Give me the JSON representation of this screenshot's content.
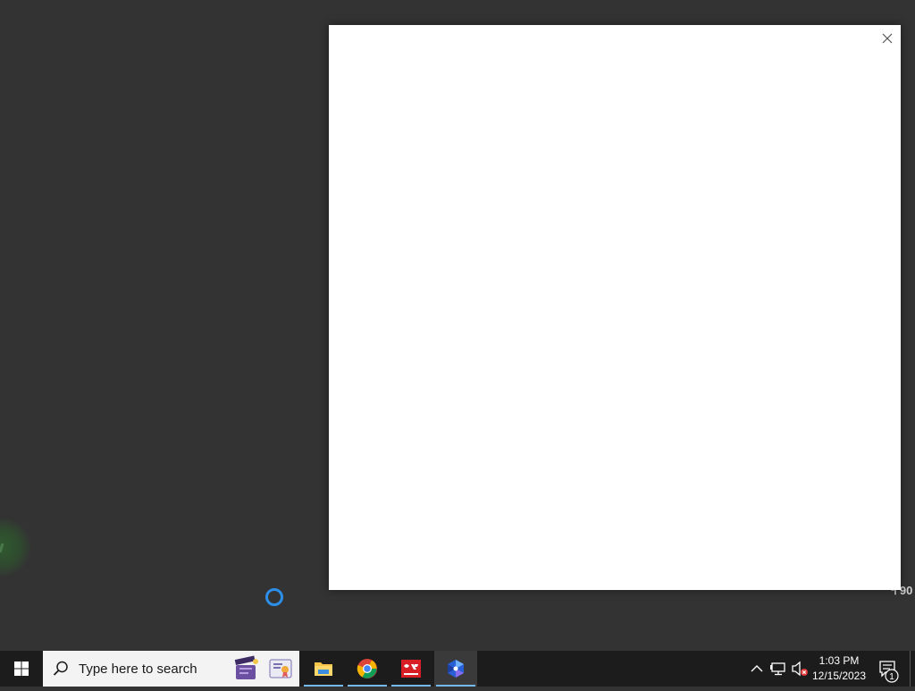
{
  "dialog": {
    "close_icon": "close-icon"
  },
  "desktop": {
    "edge_text": "ฯ 90"
  },
  "taskbar": {
    "start_icon": "windows-start-icon",
    "search": {
      "placeholder": "Type here to search",
      "icon": "search-icon"
    },
    "pinned_apps": [
      {
        "name": "file-explorer",
        "icon": "folder-icon",
        "running": true
      },
      {
        "name": "google-chrome",
        "icon": "chrome-icon",
        "running": true
      },
      {
        "name": "red-app",
        "icon": "red-app-icon",
        "running": true
      },
      {
        "name": "blue-app",
        "icon": "blue-app-icon",
        "running": true,
        "active": true
      }
    ],
    "tray": {
      "overflow_icon": "chevron-up-icon",
      "network_icon": "network-icon",
      "volume_icon": "volume-muted-icon"
    },
    "clock": {
      "time": "1:03 PM",
      "date": "12/15/2023"
    },
    "notifications": {
      "count": "1"
    }
  },
  "colors": {
    "desktop_bg": "#333333",
    "taskbar_bg": "#1c1c1c",
    "accent": "#76b9ed",
    "loading_ring": "#2d8ee8"
  }
}
